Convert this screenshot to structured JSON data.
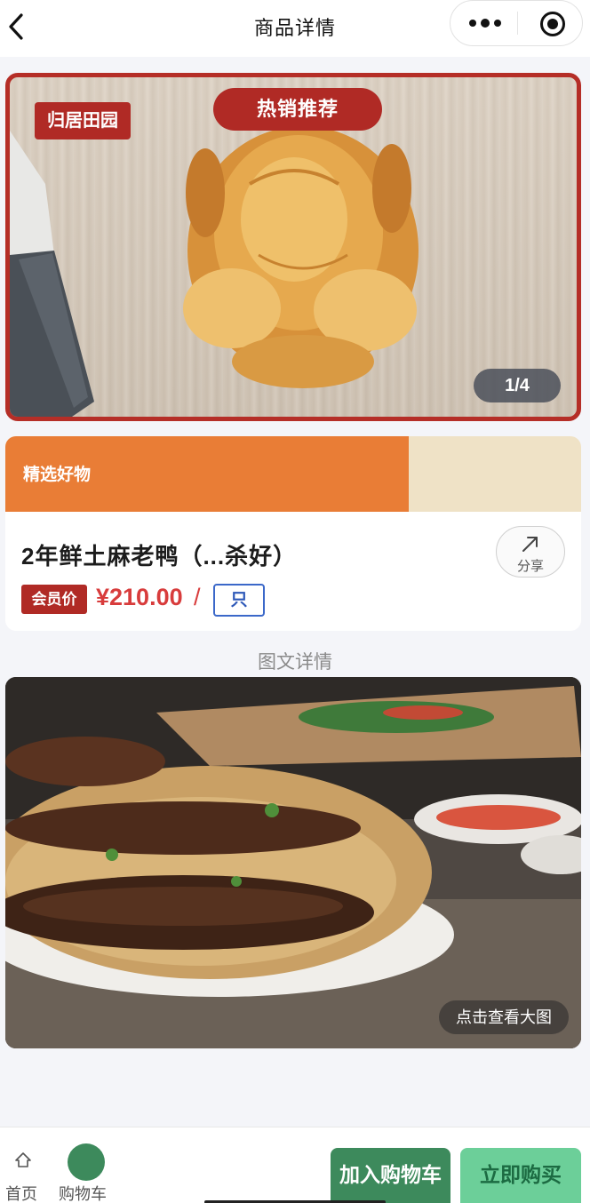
{
  "nav": {
    "title": "商品详情",
    "back_icon": "chevron-left-icon",
    "more_icon": "more-dots-icon",
    "close_icon": "target-circle-icon"
  },
  "hero": {
    "brand": "归居田园",
    "badge": "热销推荐",
    "page_indicator": "1/4",
    "border_color": "#b52e27"
  },
  "product": {
    "promo_label": "精选好物",
    "title": "2年鲜土麻老鸭（...杀好）",
    "share_label": "分享",
    "member_tag": "会员价",
    "price": "¥210.00",
    "price_separator": "/",
    "unit": "只",
    "price_color": "#d83c3c",
    "promo_color": "#e97d36"
  },
  "detail": {
    "section_title": "图文详情",
    "view_large": "点击查看大图"
  },
  "bottom": {
    "home_label": "首页",
    "cart_label": "购物车",
    "add_to_cart": "加入购物车",
    "buy_now": "立即购买",
    "primary_color": "#3d8a5c",
    "secondary_color": "#6ccf99"
  }
}
